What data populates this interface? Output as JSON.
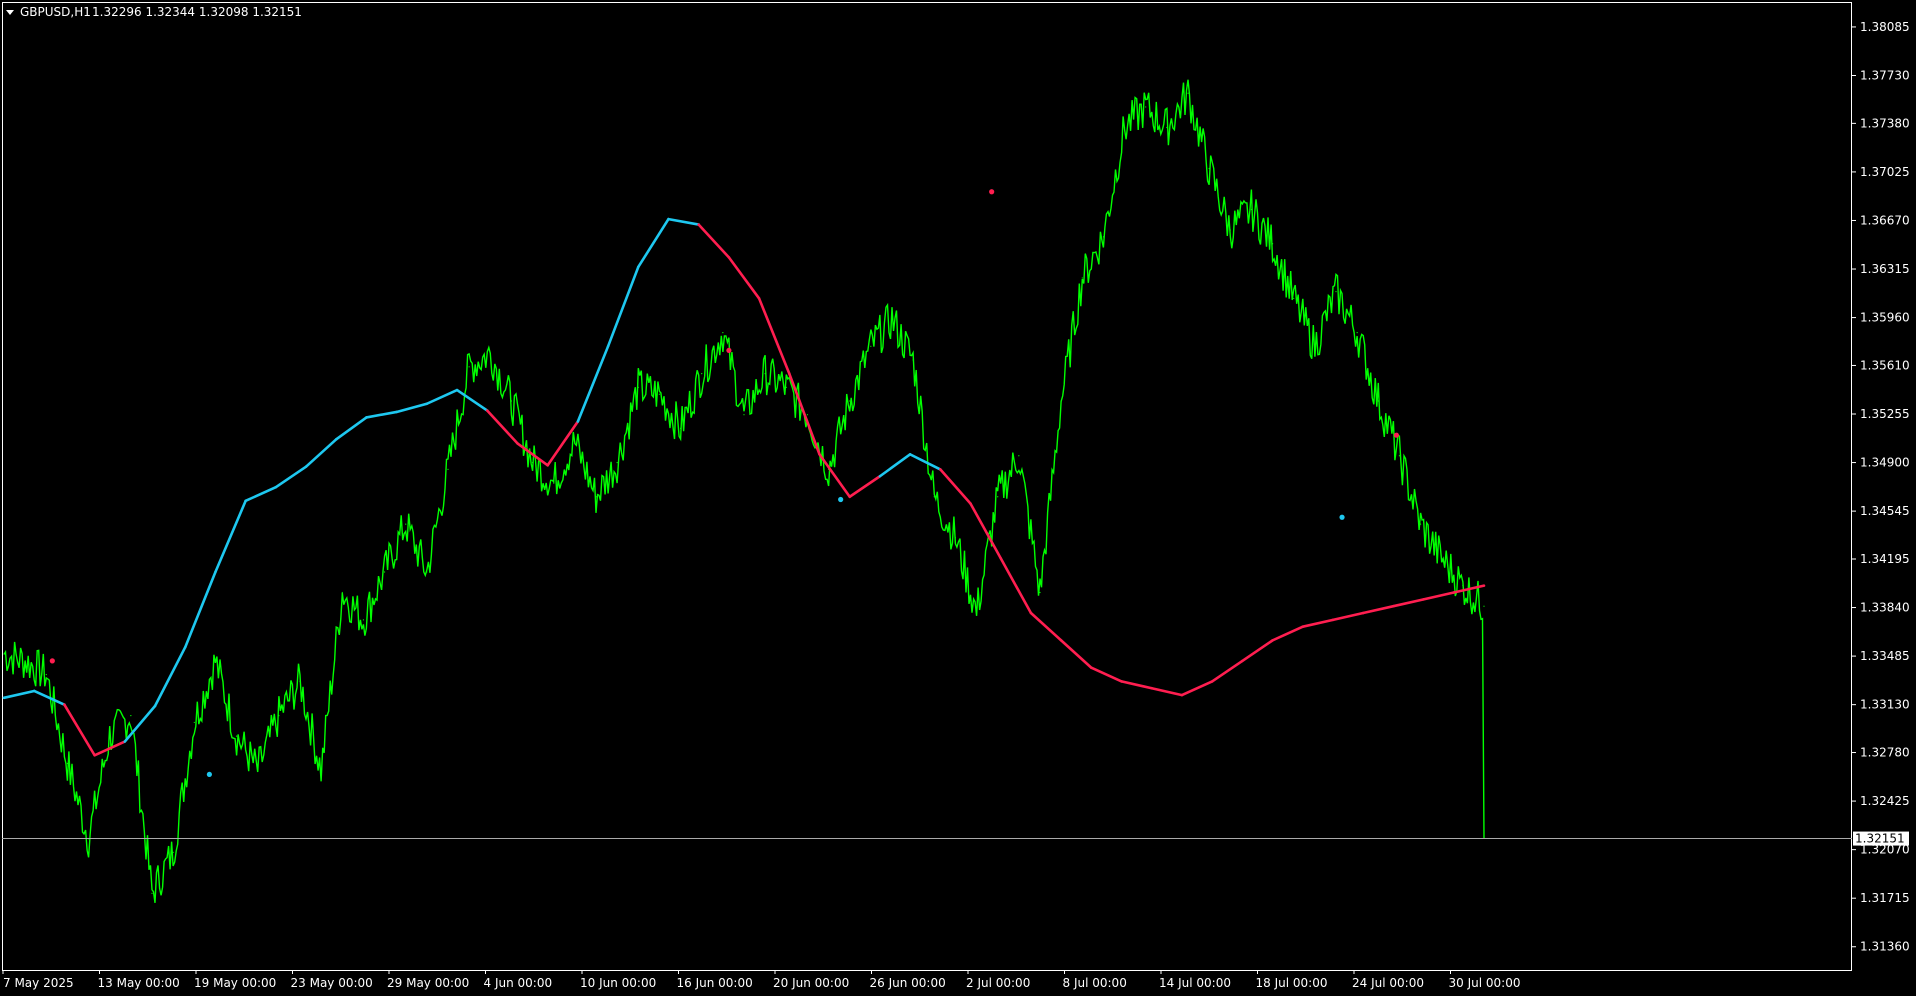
{
  "header": {
    "symbol_label": "GBPUSD,H1",
    "ohlc": "1.32296 1.32344 1.32098 1.32151"
  },
  "colors": {
    "background": "#000000",
    "price": "#00ff00",
    "ma_up": "#1ec8f0",
    "ma_down": "#ff1e50",
    "axis": "#ffffff",
    "current_price_line": "#aaaaaa"
  },
  "icons": {
    "menu_toggle": "triangle-down-icon"
  },
  "chart_data": {
    "type": "line",
    "current_price": 1.32151,
    "ylim": [
      1.3119,
      1.3826
    ],
    "y_ticks": [
      "1.38085",
      "1.37730",
      "1.37380",
      "1.37025",
      "1.36670",
      "1.36315",
      "1.35960",
      "1.35610",
      "1.35255",
      "1.34900",
      "1.34545",
      "1.34195",
      "1.33840",
      "1.33485",
      "1.33130",
      "1.32780",
      "1.32425",
      "1.32070",
      "1.31715",
      "1.31360"
    ],
    "x_ticks": [
      "7 May 2025",
      "13 May 00:00",
      "19 May 00:00",
      "23 May 00:00",
      "29 May 00:00",
      "4 Jun 00:00",
      "10 Jun 00:00",
      "16 Jun 00:00",
      "20 Jun 00:00",
      "26 Jun 00:00",
      "2 Jul 00:00",
      "8 Jul 00:00",
      "14 Jul 00:00",
      "18 Jul 00:00",
      "24 Jul 00:00",
      "30 Jul 00:00"
    ],
    "price_series": {
      "x": [
        0,
        7,
        14,
        21,
        28,
        35,
        42,
        49,
        56,
        63,
        70,
        77,
        84,
        91,
        98,
        105,
        112,
        119,
        126,
        133,
        140,
        147,
        154,
        161,
        168,
        175,
        182,
        189,
        196,
        203,
        210,
        217,
        224,
        231,
        238,
        245,
        252,
        259,
        266,
        273,
        280,
        287,
        294,
        301,
        308,
        315,
        322,
        329,
        336,
        343,
        350,
        357,
        364,
        371,
        378,
        385,
        392,
        399,
        406,
        413,
        420,
        427,
        434,
        441,
        448,
        455,
        462,
        469,
        476,
        483,
        490
      ],
      "y": [
        1.335,
        1.3345,
        1.3335,
        1.327,
        1.3215,
        1.329,
        1.3305,
        1.3175,
        1.3205,
        1.33,
        1.3345,
        1.329,
        1.3265,
        1.3305,
        1.333,
        1.3265,
        1.3395,
        1.3375,
        1.341,
        1.3445,
        1.341,
        1.3485,
        1.356,
        1.357,
        1.3535,
        1.349,
        1.3475,
        1.3505,
        1.3465,
        1.349,
        1.3545,
        1.354,
        1.3515,
        1.3555,
        1.3585,
        1.3525,
        1.3555,
        1.3545,
        1.3525,
        1.3485,
        1.3535,
        1.3575,
        1.3595,
        1.3565,
        1.3465,
        1.3435,
        1.338,
        1.3465,
        1.3495,
        1.3395,
        1.3535,
        1.3625,
        1.3655,
        1.3735,
        1.375,
        1.3735,
        1.376,
        1.3705,
        1.366,
        1.3675,
        1.365,
        1.361,
        1.3575,
        1.3615,
        1.3585,
        1.3535,
        1.3495,
        1.3445,
        1.342,
        1.34,
        1.3385,
        1.3405,
        1.344,
        1.3475,
        1.3445,
        1.3515,
        1.3525,
        1.3585,
        1.352,
        1.3455,
        1.3435,
        1.3365,
        1.3345,
        1.3375,
        1.3315,
        1.3225,
        1.32151
      ]
    },
    "ma_series": {
      "x": [
        0,
        10,
        20,
        30,
        40,
        50,
        60,
        70,
        80,
        90,
        100,
        110,
        120,
        130,
        140,
        150,
        160,
        170,
        180,
        190,
        200,
        210,
        220,
        230,
        240,
        250,
        260,
        270,
        280,
        290,
        300,
        310,
        320,
        330,
        340,
        350,
        360,
        370,
        380,
        390,
        400,
        410,
        420,
        430,
        440,
        450,
        460,
        470,
        480,
        490
      ],
      "y": [
        1.3318,
        1.3323,
        1.3313,
        1.3276,
        1.3286,
        1.3312,
        1.3355,
        1.341,
        1.3462,
        1.3472,
        1.3487,
        1.3507,
        1.3523,
        1.3527,
        1.3533,
        1.3543,
        1.3528,
        1.3504,
        1.3488,
        1.352,
        1.3575,
        1.3633,
        1.3668,
        1.3664,
        1.364,
        1.361,
        1.3555,
        1.3496,
        1.3465,
        1.348,
        1.3496,
        1.3485,
        1.346,
        1.342,
        1.338,
        1.336,
        1.334,
        1.333,
        1.3325,
        1.332,
        1.333,
        1.3345,
        1.336,
        1.337,
        1.3375,
        1.338,
        1.3385,
        1.339,
        1.3395,
        1.34
      ],
      "direction": [
        "up",
        "up",
        "down",
        "down",
        "up",
        "up",
        "up",
        "up",
        "up",
        "up",
        "up",
        "up",
        "up",
        "up",
        "up",
        "up",
        "down",
        "down",
        "down",
        "up",
        "up",
        "up",
        "up",
        "down",
        "down",
        "down",
        "down",
        "down",
        "down",
        "up",
        "up",
        "down",
        "down",
        "down",
        "down",
        "down",
        "down",
        "down",
        "down",
        "down",
        "down",
        "down",
        "down",
        "down",
        "down",
        "down",
        "down",
        "down",
        "down",
        "down"
      ]
    },
    "signals": [
      {
        "x": 16,
        "y": 1.3345,
        "type": "sell"
      },
      {
        "x": 68,
        "y": 1.3262,
        "type": "buy"
      },
      {
        "x": 240,
        "y": 1.3572,
        "type": "sell"
      },
      {
        "x": 277,
        "y": 1.3463,
        "type": "buy"
      },
      {
        "x": 327,
        "y": 1.3688,
        "type": "sell"
      },
      {
        "x": 443,
        "y": 1.345,
        "type": "buy"
      },
      {
        "x": 461,
        "y": 1.351,
        "type": "sell"
      }
    ]
  }
}
